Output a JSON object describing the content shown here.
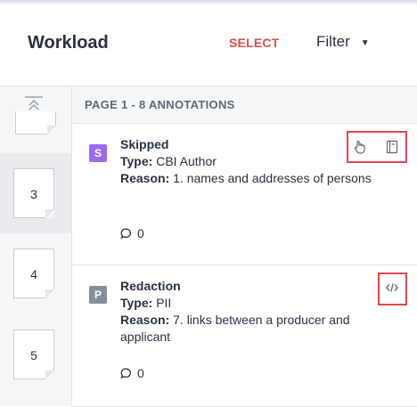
{
  "header": {
    "title": "Workload",
    "select_label": "SELECT",
    "filter_label": "Filter"
  },
  "content": {
    "page_heading": "PAGE 1 - 8 ANNOTATIONS"
  },
  "pages": [
    {
      "num": "3"
    },
    {
      "num": "4"
    },
    {
      "num": "5"
    }
  ],
  "annotations": [
    {
      "badge": "S",
      "badge_color": "#9b6be8",
      "name": "Skipped",
      "type_label": "Type:",
      "type_value": "CBI Author",
      "reason_label": "Reason:",
      "reason_value": "1. names and addresses of persons",
      "comment_count": "0",
      "actions": [
        "hand-icon",
        "note-icon"
      ]
    },
    {
      "badge": "P",
      "badge_color": "#868e98",
      "name": "Redaction",
      "type_label": "Type:",
      "type_value": "PII",
      "reason_label": "Reason:",
      "reason_value": "7. links between a producer and applicant",
      "comment_count": "0",
      "actions": [
        "code-icon"
      ]
    }
  ],
  "colors": {
    "accent": "#dd4d50",
    "highlight_box": "#e0474c"
  }
}
